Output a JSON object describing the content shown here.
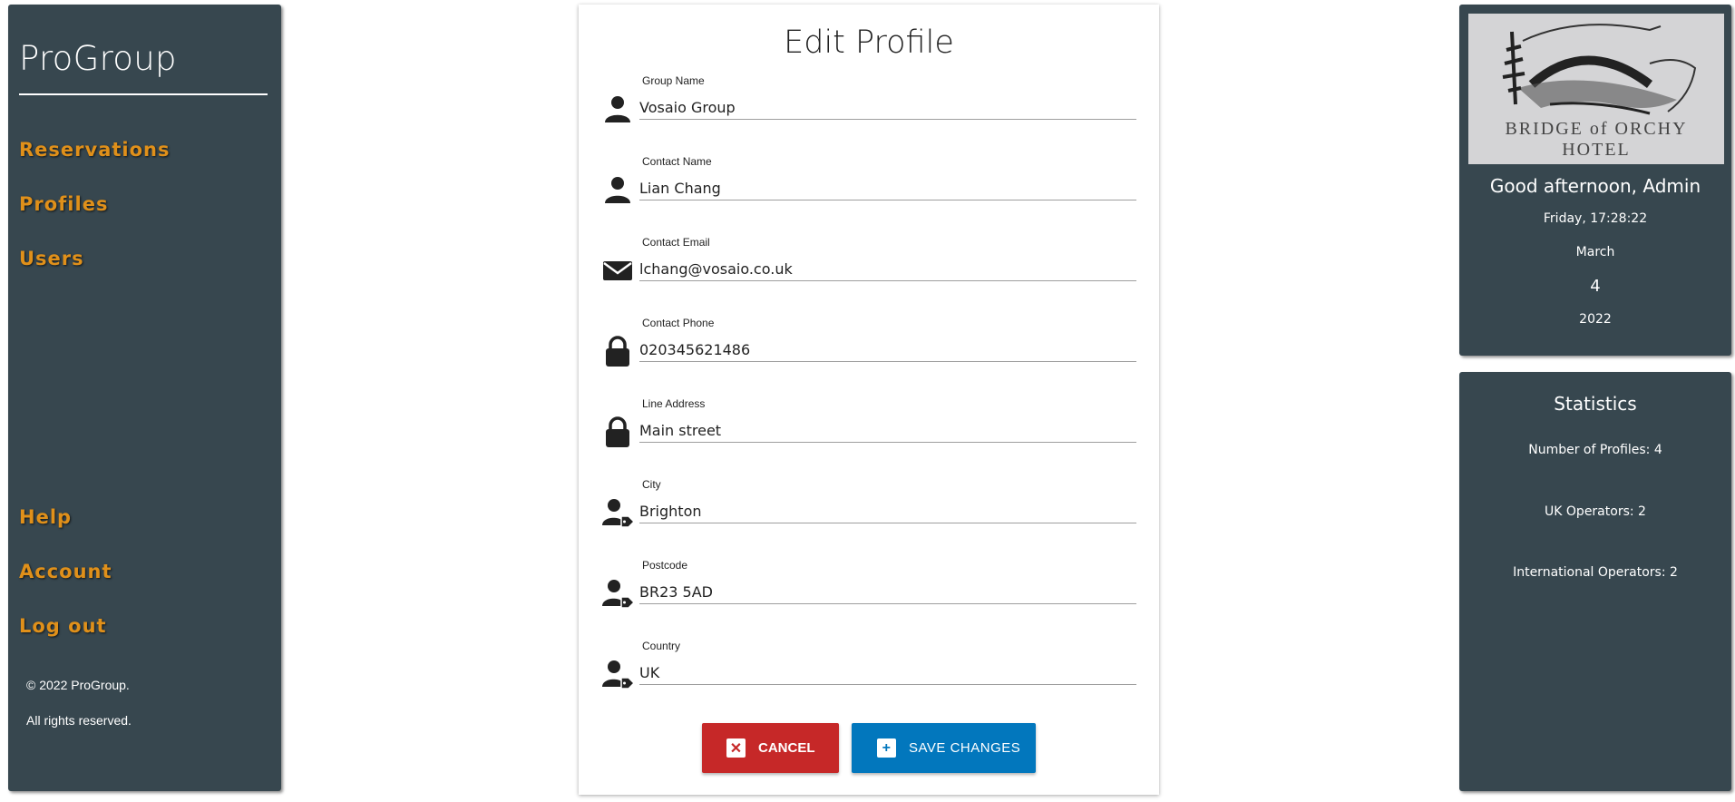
{
  "sidebar": {
    "brand": "ProGroup",
    "nav": [
      "Reservations",
      "Profiles",
      "Users"
    ],
    "nav_bottom": [
      "Help",
      "Account",
      "Log out"
    ],
    "copyright": "© 2022 ProGroup.",
    "rights": "All rights reserved."
  },
  "form": {
    "title": "Edit Profile",
    "fields": [
      {
        "label": "Group Name",
        "value": "Vosaio Group",
        "icon": "person-icon"
      },
      {
        "label": "Contact Name",
        "value": "Lian Chang",
        "icon": "person-icon"
      },
      {
        "label": "Contact Email",
        "value": "lchang@vosaio.co.uk",
        "icon": "envelope-icon"
      },
      {
        "label": "Contact Phone",
        "value": "020345621486",
        "icon": "lock-icon"
      },
      {
        "label": "Line Address",
        "value": "Main street",
        "icon": "lock-icon"
      },
      {
        "label": "City",
        "value": "Brighton",
        "icon": "person-tag-icon"
      },
      {
        "label": "Postcode",
        "value": "BR23 5AD",
        "icon": "person-tag-icon"
      },
      {
        "label": "Country",
        "value": "UK",
        "icon": "person-tag-icon"
      }
    ],
    "cancel_label": "CANCEL",
    "save_label": "SAVE CHANGES"
  },
  "info": {
    "logo_text": "BRIDGE of ORCHY HOTEL",
    "greeting": "Good afternoon, Admin",
    "day_time": "Friday, 17:28:22",
    "month": "March",
    "day": "4",
    "year": "2022"
  },
  "stats": {
    "title": "Statistics",
    "profiles": "Number of Profiles: 4",
    "uk": "UK Operators: 2",
    "intl": "International Operators: 2"
  },
  "colors": {
    "sidebar_bg": "#37474f",
    "nav_accent": "#e0901a",
    "cancel": "#c62828",
    "save": "#0277bd"
  }
}
